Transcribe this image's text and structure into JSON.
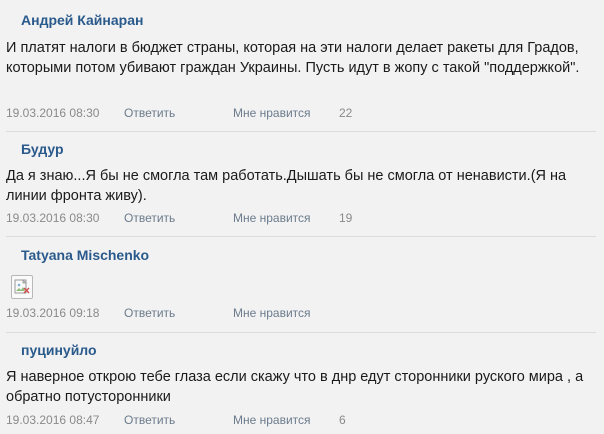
{
  "comments": [
    {
      "author": "Андрей Кайнаран",
      "text": "И платят налоги в бюджет страны, которая на эти налоги делает ракеты для Градов, которыми потом убивают граждан Украины. Пусть идут в жопу с такой \"поддержкой\".",
      "date": "19.03.2016 08:30",
      "reply": "Ответить",
      "like": "Мне нравится",
      "likes": "22"
    },
    {
      "author": "Будур",
      "text": "Да я знаю...Я бы не смогла там работать.Дышать бы не смогла от ненависти.(Я на линии фронта живу).",
      "date": "19.03.2016 08:30",
      "reply": "Ответить",
      "like": "Мне нравится",
      "likes": "19"
    },
    {
      "author": "Tatyana Mischenko",
      "image_icon": "broken-image-icon",
      "date": "19.03.2016 09:18",
      "reply": "Ответить",
      "like": "Мне нравится"
    },
    {
      "author": "пуцинуйло",
      "text": "Я наверное открою тебе глаза если скажу что в днр едут сторонники руского мира , а обратно потусторонники",
      "date": "19.03.2016 08:47",
      "reply": "Ответить",
      "like": "Мне нравится",
      "likes": "6"
    }
  ]
}
